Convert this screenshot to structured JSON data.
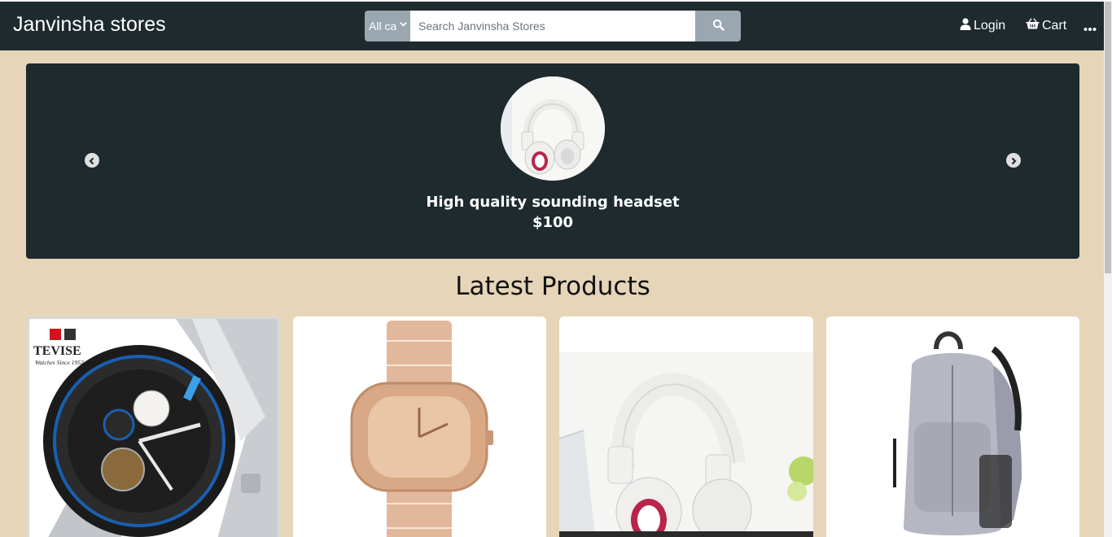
{
  "header": {
    "brand": "Janvinsha stores",
    "category_select": "All ca",
    "search_placeholder": "Search Janvinsha Stores",
    "login_label": "Login",
    "cart_label": "Cart"
  },
  "carousel": {
    "title": "High quality sounding headset",
    "price": "$100"
  },
  "latest": {
    "heading": "Latest Products"
  },
  "products": [
    {
      "icon": "watch-image",
      "logo_text": "TEVISE",
      "logo_sub": "Watches Since 1952"
    },
    {
      "icon": "gold-watch-image"
    },
    {
      "icon": "headphones-image"
    },
    {
      "icon": "backpack-image"
    }
  ],
  "colors": {
    "background": "#e6d5b8",
    "navbar": "#1e2a2e",
    "search_accent": "#9aa6b0"
  }
}
